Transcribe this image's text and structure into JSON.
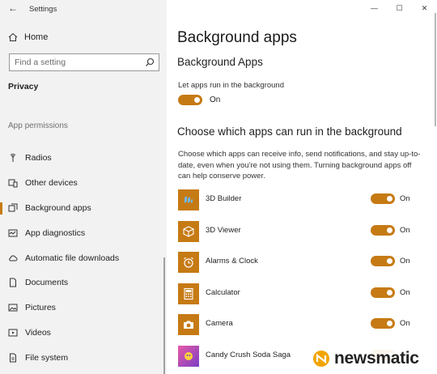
{
  "window": {
    "title": "Settings",
    "controls": {
      "minimize": "—",
      "maximize": "☐",
      "close": "✕"
    }
  },
  "sidebar": {
    "home_label": "Home",
    "search_placeholder": "Find a setting",
    "section_title": "Privacy",
    "subsection_title": "App permissions",
    "items": [
      {
        "label": "Radios",
        "icon": "radio-icon"
      },
      {
        "label": "Other devices",
        "icon": "devices-icon"
      },
      {
        "label": "Background apps",
        "icon": "background-apps-icon",
        "active": true
      },
      {
        "label": "App diagnostics",
        "icon": "diagnostics-icon"
      },
      {
        "label": "Automatic file downloads",
        "icon": "cloud-icon"
      },
      {
        "label": "Documents",
        "icon": "document-icon"
      },
      {
        "label": "Pictures",
        "icon": "picture-icon"
      },
      {
        "label": "Videos",
        "icon": "video-icon"
      },
      {
        "label": "File system",
        "icon": "file-system-icon"
      }
    ]
  },
  "main": {
    "page_title": "Background apps",
    "section1_title": "Background Apps",
    "let_apps_label": "Let apps run in the background",
    "master_toggle_state": "On",
    "section2_title": "Choose which apps can run in the background",
    "description": "Choose which apps can receive info, send notifications, and stay up-to-date, even when you're not using them. Turning background apps off can help conserve power.",
    "apps": [
      {
        "name": "3D Builder",
        "state": "On",
        "icon": "3d-builder-icon"
      },
      {
        "name": "3D Viewer",
        "state": "On",
        "icon": "3d-viewer-icon"
      },
      {
        "name": "Alarms & Clock",
        "state": "On",
        "icon": "alarm-clock-icon"
      },
      {
        "name": "Calculator",
        "state": "On",
        "icon": "calculator-icon"
      },
      {
        "name": "Camera",
        "state": "On",
        "icon": "camera-icon"
      },
      {
        "name": "Candy Crush Soda Saga",
        "state": "On",
        "icon": "candy-crush-icon"
      }
    ]
  },
  "watermark": {
    "text": "newsmatic"
  },
  "colors": {
    "accent": "#c67a14",
    "sidebar_bg": "#f2f2f2"
  }
}
